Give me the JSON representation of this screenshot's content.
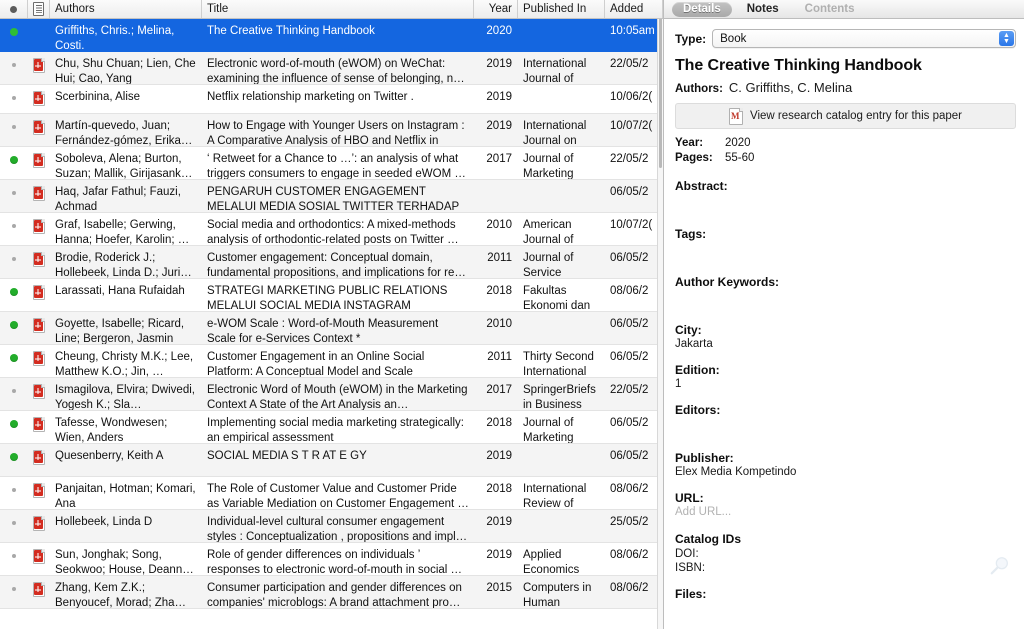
{
  "list": {
    "columns": [
      {
        "key": "status",
        "label": "",
        "icon": "status-dot-icon"
      },
      {
        "key": "doc",
        "label": "",
        "icon": "document-icon"
      },
      {
        "key": "authors",
        "label": "Authors"
      },
      {
        "key": "title",
        "label": "Title"
      },
      {
        "key": "year",
        "label": "Year"
      },
      {
        "key": "published_in",
        "label": "Published In"
      },
      {
        "key": "added",
        "label": "Added"
      }
    ],
    "rows": [
      {
        "status": "green",
        "doc": "none",
        "authors": "Griffiths, Chris.; Melina, Costi.",
        "title": "The Creative Thinking Handbook",
        "year": "2020",
        "published_in": "",
        "added": "10:05am",
        "selected": true
      },
      {
        "status": "gray",
        "doc": "pdf",
        "authors": "Chu, Shu Chuan; Lien, Che Hui; Cao, Yang",
        "title": "Electronic word-of-mouth (eWOM) on WeChat: examining the influence of sense of belonging, n…",
        "year": "2019",
        "published_in": "International Journal of Ad…",
        "added": "22/05/2",
        "selected": false
      },
      {
        "status": "gray",
        "doc": "pdf",
        "authors": "Scerbinina, Alise",
        "title": "Netflix relationship marketing on Twitter .",
        "year": "2019",
        "published_in": "",
        "added": "10/06/2(",
        "selected": false
      },
      {
        "status": "gray",
        "doc": "pdf",
        "authors": "Martín-quevedo, Juan; Fernández-gómez, Erika…",
        "title": "How to Engage with Younger Users on Instagram : A Comparative Analysis of HBO and Netflix in the…",
        "year": "2019",
        "published_in": "International Journal on M…",
        "added": "10/07/2(",
        "selected": false
      },
      {
        "status": "green",
        "doc": "pdf",
        "authors": "Soboleva, Alena; Burton, Suzan; Mallik, Girijasank…",
        "title": "‘ Retweet for a Chance to …’: an analysis of what triggers consumers to engage in seeded eWOM …",
        "year": "2017",
        "published_in": "Journal of Marketing Ma…",
        "added": "22/05/2",
        "selected": false
      },
      {
        "status": "gray",
        "doc": "pdf",
        "authors": "Haq, Jafar Fathul; Fauzi, Achmad",
        "title": "PENGARUH CUSTOMER ENGAGEMENT MELALUI MEDIA SOSIAL TWITTER TERHADAP PEMBENTU…",
        "year": "",
        "published_in": "",
        "added": "06/05/2",
        "selected": false
      },
      {
        "status": "gray",
        "doc": "pdf",
        "authors": "Graf, Isabelle; Gerwing, Hanna; Hoefer, Karolin; …",
        "title": "Social media and orthodontics: A mixed-methods analysis of orthodontic-related posts on Twitter …",
        "year": "2010",
        "published_in": "American Journal of Ort…",
        "added": "10/07/2(",
        "selected": false
      },
      {
        "status": "gray",
        "doc": "pdf",
        "authors": "Brodie, Roderick J.; Hollebeek, Linda D.; Juri…",
        "title": "Customer engagement: Conceptual domain, fundamental propositions, and implications for re…",
        "year": "2011",
        "published_in": "Journal of Service Rese…",
        "added": "06/05/2",
        "selected": false
      },
      {
        "status": "green",
        "doc": "pdf",
        "authors": "Larassati, Hana Rufaidah",
        "title": "STRATEGI MARKETING PUBLIC RELATIONS MELALUI SOCIAL MEDIA INSTAGRAM @TRAVEL…",
        "year": "2018",
        "published_in": "Fakultas Ekonomi dan …",
        "added": "08/06/2",
        "selected": false
      },
      {
        "status": "green",
        "doc": "pdf",
        "authors": "Goyette, Isabelle; Ricard, Line; Bergeron, Jasmin",
        "title": "e-WOM Scale : Word-of-Mouth Measurement Scale for e-Services Context *",
        "year": "2010",
        "published_in": "",
        "added": "06/05/2",
        "selected": false
      },
      {
        "status": "green",
        "doc": "pdf",
        "authors": "Cheung, Christy M.K.; Lee, Matthew K.O.; Jin, …",
        "title": "Customer Engagement in an Online Social Platform: A Conceptual Model and Scale Develop…",
        "year": "2011",
        "published_in": "Thirty Second International …",
        "added": "06/05/2",
        "selected": false
      },
      {
        "status": "gray",
        "doc": "pdf",
        "authors": "Ismagilova, Elvira; Dwivedi, Yogesh K.; Sla…",
        "title": "Electronic Word of Mouth (eWOM) in the Marketing Context A State of the Art Analysis an…",
        "year": "2017",
        "published_in": "SpringerBriefs in Business",
        "added": "22/05/2",
        "selected": false
      },
      {
        "status": "green",
        "doc": "pdf",
        "authors": "Tafesse, Wondwesen; Wien, Anders",
        "title": "Implementing social media marketing strategically: an empirical assessment",
        "year": "2018",
        "published_in": "Journal of Marketing Ma…",
        "added": "06/05/2",
        "selected": false
      },
      {
        "status": "green",
        "doc": "pdf",
        "authors": "Quesenberry, Keith A",
        "title": "SOCIAL MEDIA S T R AT E GY",
        "year": "2019",
        "published_in": "",
        "added": "06/05/2",
        "selected": false
      },
      {
        "status": "gray",
        "doc": "pdf",
        "authors": "Panjaitan, Hotman; Komari, Ana",
        "title": "The Role of Customer Value and Customer Pride as Variable Mediation on Customer Engagement …",
        "year": "2018",
        "published_in": "International Review of Ma…",
        "added": "08/06/2",
        "selected": false
      },
      {
        "status": "gray",
        "doc": "pdf",
        "authors": "Hollebeek, Linda D",
        "title": "Individual-level cultural consumer engagement styles : Conceptualization , propositions and impl…",
        "year": "2019",
        "published_in": "",
        "added": "25/05/2",
        "selected": false
      },
      {
        "status": "gray",
        "doc": "pdf",
        "authors": "Sun, Jonghak; Song, Seokwoo; House, Deann…",
        "title": "Role of gender differences on individuals ’ responses to electronic word-of-mouth in social …",
        "year": "2019",
        "published_in": "Applied Economics",
        "added": "08/06/2",
        "selected": false
      },
      {
        "status": "gray",
        "doc": "pdf",
        "authors": "Zhang, Kem Z.K.; Benyoucef, Morad; Zha…",
        "title": "Consumer participation and gender differences on companies' microblogs: A brand attachment pro…",
        "year": "2015",
        "published_in": "Computers in Human Behav…",
        "added": "08/06/2",
        "selected": false
      }
    ]
  },
  "details": {
    "tabs": [
      {
        "label": "Details",
        "state": "active"
      },
      {
        "label": "Notes",
        "state": "enabled"
      },
      {
        "label": "Contents",
        "state": "disabled"
      }
    ],
    "type_label": "Type:",
    "type_value": "Book",
    "title": "The Creative Thinking Handbook",
    "authors_label": "Authors:",
    "authors_value": "C. Griffiths, C. Melina",
    "catalog_button": "View research catalog entry for this paper",
    "year_label": "Year:",
    "year_value": "2020",
    "pages_label": "Pages:",
    "pages_value": "55-60",
    "abstract_label": "Abstract:",
    "abstract_value": "",
    "tags_label": "Tags:",
    "tags_value": "",
    "author_keywords_label": "Author Keywords:",
    "author_keywords_value": "",
    "city_label": "City:",
    "city_value": "Jakarta",
    "edition_label": "Edition:",
    "edition_value": "1",
    "editors_label": "Editors:",
    "editors_value": "",
    "publisher_label": "Publisher:",
    "publisher_value": "Elex Media Kompetindo",
    "url_label": "URL:",
    "url_placeholder": "Add URL...",
    "catalog_ids_label": "Catalog IDs",
    "doi_label": "DOI:",
    "isbn_label": "ISBN:",
    "files_label": "Files:"
  },
  "colors": {
    "selection_blue": "#1466e0",
    "unread_green": "#23ad2b",
    "pdf_red": "#d32c20",
    "stepper_blue": "#2a76e8"
  }
}
